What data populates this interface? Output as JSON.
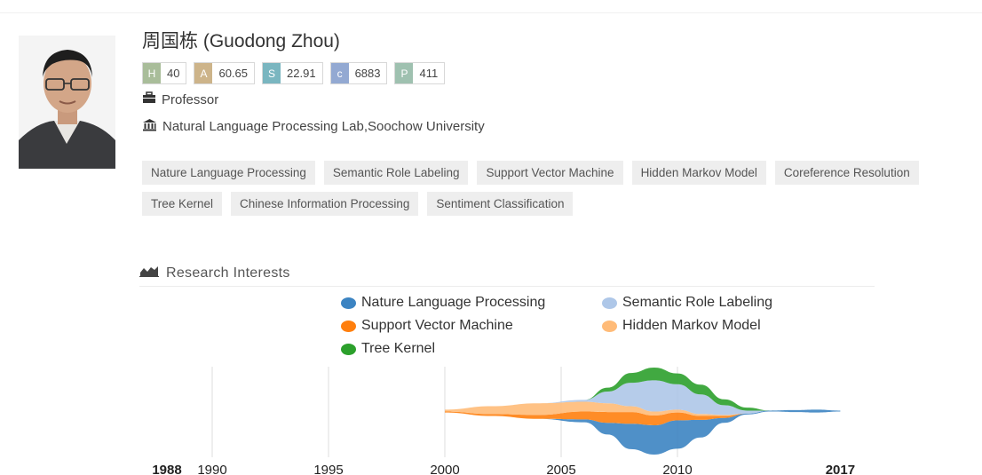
{
  "profile": {
    "name": "周国栋 (Guodong Zhou)",
    "position": "Professor",
    "affiliation": "Natural Language Processing Lab,Soochow University",
    "metrics": [
      {
        "key": "H",
        "value": "40",
        "color": "#a9bd9a"
      },
      {
        "key": "A",
        "value": "60.65",
        "color": "#cdb48a"
      },
      {
        "key": "S",
        "value": "22.91",
        "color": "#7ab6c0"
      },
      {
        "key": "c",
        "value": "6883",
        "color": "#93a9d2"
      },
      {
        "key": "P",
        "value": "411",
        "color": "#9fc1b0"
      }
    ],
    "icons": {
      "position": "briefcase-icon",
      "affiliation": "institution-icon"
    }
  },
  "tags": [
    "Nature Language Processing",
    "Semantic Role Labeling",
    "Support Vector Machine",
    "Hidden Markov Model",
    "Coreference Resolution",
    "Tree Kernel",
    "Chinese Information Processing",
    "Sentiment Classification"
  ],
  "research": {
    "title": "Research Interests",
    "icon": "area-chart-icon"
  },
  "chart_data": {
    "type": "area",
    "title": "",
    "x_range": [
      1988,
      2017
    ],
    "x_ticks": [
      "1988",
      "1990",
      "1995",
      "2000",
      "2005",
      "2010",
      "2017"
    ],
    "bold_ticks": [
      "1988",
      "2017"
    ],
    "vertical_gridlines": [
      1990,
      1995,
      2000,
      2005,
      2010
    ],
    "legend_placement": "top",
    "years": [
      2000,
      2002,
      2004,
      2006,
      2007,
      2008,
      2009,
      2010,
      2011,
      2012,
      2013,
      2014,
      2015,
      2016,
      2017
    ],
    "series": [
      {
        "name": "Nature Language Processing",
        "color": "#3c84c2",
        "values": [
          0,
          0,
          0,
          0.3,
          1.2,
          2.6,
          3.0,
          2.9,
          1.8,
          0.5,
          0.1,
          0.1,
          0.2,
          0.3,
          0.1
        ]
      },
      {
        "name": "Semantic Role Labeling",
        "color": "#aec7e8",
        "values": [
          0,
          0,
          0,
          0.2,
          1.2,
          2.4,
          3.2,
          2.6,
          2.0,
          1.0,
          0.3,
          0,
          0,
          0,
          0
        ]
      },
      {
        "name": "Support Vector Machine",
        "color": "#ff7f0e",
        "values": [
          0.1,
          0.2,
          0.4,
          0.8,
          1.1,
          1.2,
          1.0,
          0.8,
          0.4,
          0.2,
          0,
          0,
          0,
          0,
          0
        ]
      },
      {
        "name": "Hidden Markov Model",
        "color": "#ffbb78",
        "values": [
          0.2,
          0.8,
          1.2,
          1.0,
          0.9,
          0.6,
          0.4,
          0.3,
          0.2,
          0.1,
          0,
          0,
          0,
          0,
          0
        ]
      },
      {
        "name": "Tree Kernel",
        "color": "#2ca02c",
        "values": [
          0,
          0,
          0,
          0,
          0.4,
          1.0,
          1.3,
          1.1,
          1.0,
          0.6,
          0.3,
          0,
          0,
          0,
          0
        ]
      }
    ]
  }
}
